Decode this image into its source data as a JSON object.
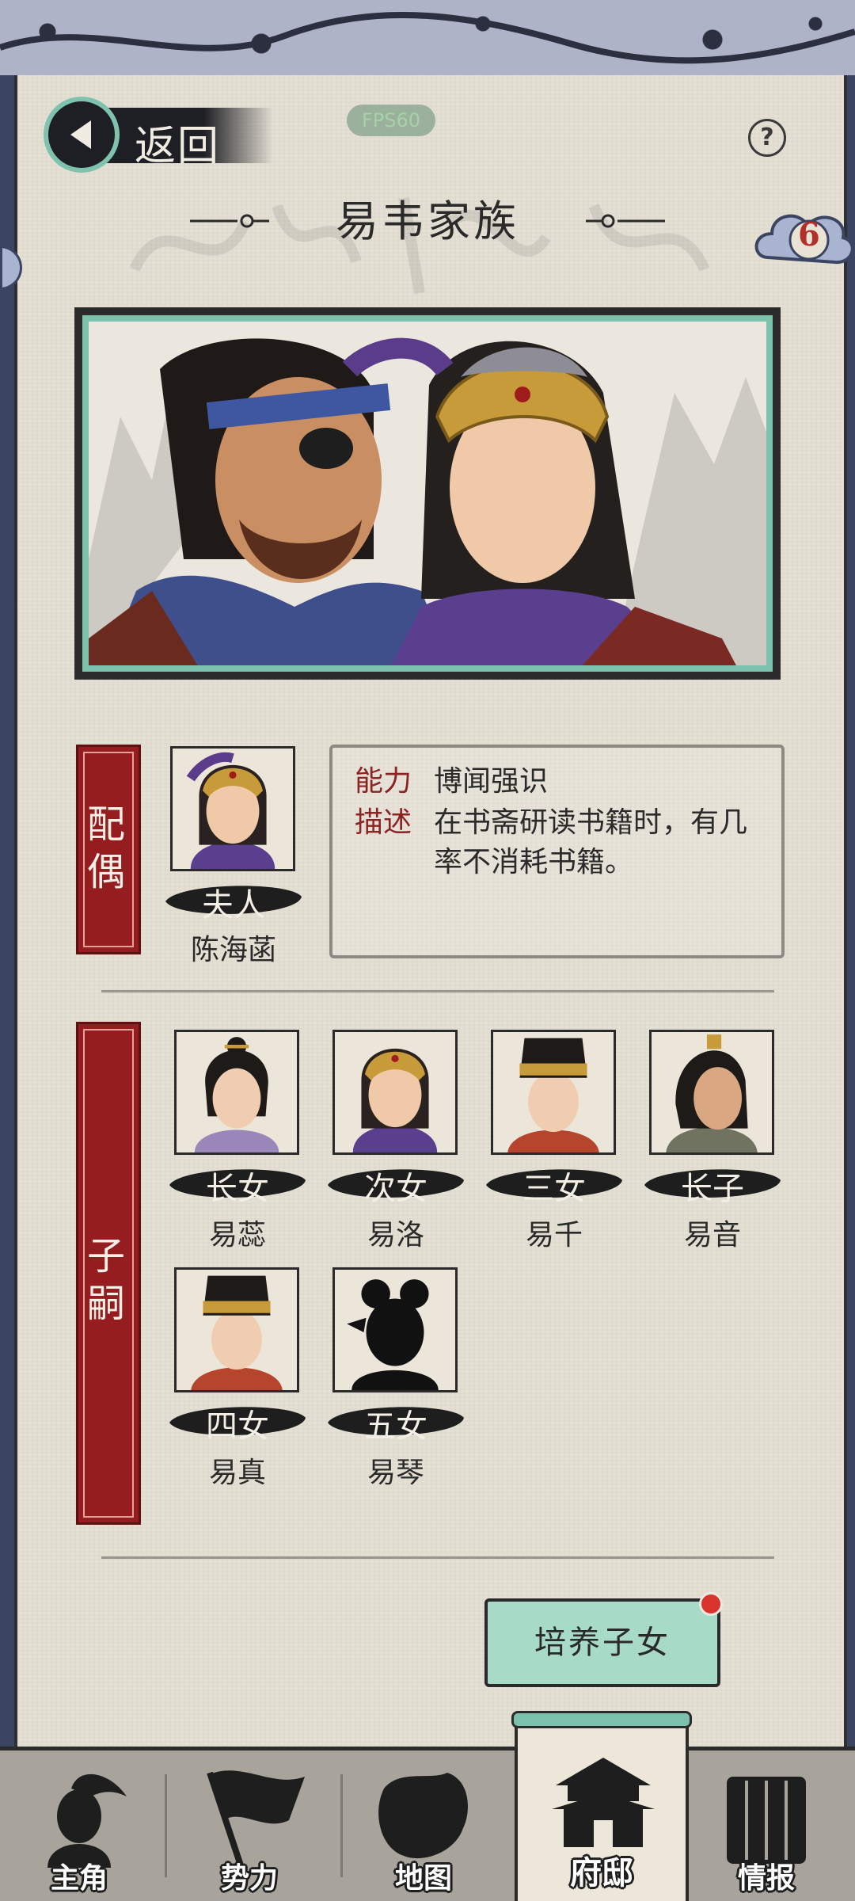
{
  "header": {
    "back_label": "返回",
    "fps_label": "FPS60",
    "help_icon": "question-icon",
    "title": "易韦家族",
    "badge_count": "6"
  },
  "spouse": {
    "section_label": [
      "配",
      "偶"
    ],
    "role": "夫人",
    "name": "陈海菡",
    "ability_key": "能力",
    "ability_value": "博闻强识",
    "desc_key": "描述",
    "desc_value": "在书斋研读书籍时，有几率不消耗书籍。"
  },
  "children": {
    "section_label": [
      "子",
      "嗣"
    ],
    "items": [
      {
        "role": "长女",
        "name": "易蕊"
      },
      {
        "role": "次女",
        "name": "易洛"
      },
      {
        "role": "三女",
        "name": "易千"
      },
      {
        "role": "长子",
        "name": "易音"
      },
      {
        "role": "四女",
        "name": "易真"
      },
      {
        "role": "五女",
        "name": "易琴"
      }
    ]
  },
  "actions": {
    "train_label": "培养子女"
  },
  "bottom_nav": {
    "items": [
      {
        "label": "主角",
        "icon": "hero-icon"
      },
      {
        "label": "势力",
        "icon": "flag-icon"
      },
      {
        "label": "地图",
        "icon": "map-icon"
      },
      {
        "label": "府邸",
        "icon": "mansion-icon"
      },
      {
        "label": "情报",
        "icon": "scroll-icon"
      }
    ],
    "active": "府邸"
  },
  "colors": {
    "accent_teal": "#7cc1ab",
    "section_red": "#951c1f",
    "parchment": "#e5e0d4",
    "notification_red": "#d8342d"
  }
}
